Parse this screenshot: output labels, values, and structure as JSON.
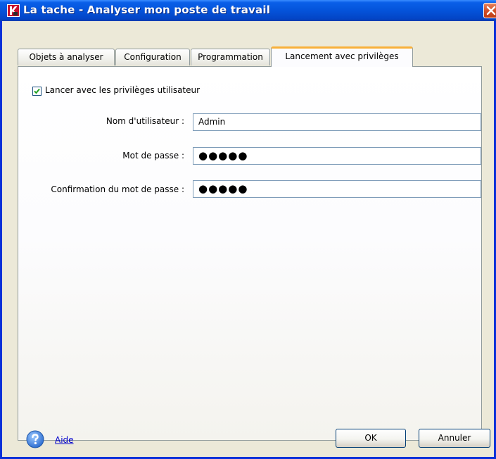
{
  "window": {
    "title": "La tache - Analyser mon poste de travail",
    "logo_icon": "kaspersky-k-icon",
    "close_icon": "close-icon"
  },
  "tabs": [
    {
      "label": "Objets à analyser",
      "active": false
    },
    {
      "label": "Configuration",
      "active": false
    },
    {
      "label": "Programmation",
      "active": false
    },
    {
      "label": "Lancement avec privilèges",
      "active": true
    }
  ],
  "form": {
    "checkbox_label": "Lancer avec les privilèges utilisateur",
    "checkbox_checked": true,
    "username_label": "Nom d'utilisateur :",
    "username_value": "Admin",
    "password_label": "Mot de passe :",
    "password_value": "●●●●●",
    "confirm_label": "Confirmation du mot de passe :",
    "confirm_value": "●●●●●"
  },
  "footer": {
    "help_icon": "help-question-icon",
    "help_label": "Aide",
    "ok_label": "OK",
    "cancel_label": "Annuler"
  },
  "colors": {
    "titlebar": "#0453DA",
    "active_tab_accent": "#F8B03A",
    "close_button": "#D2512A",
    "link": "#0000CC"
  }
}
